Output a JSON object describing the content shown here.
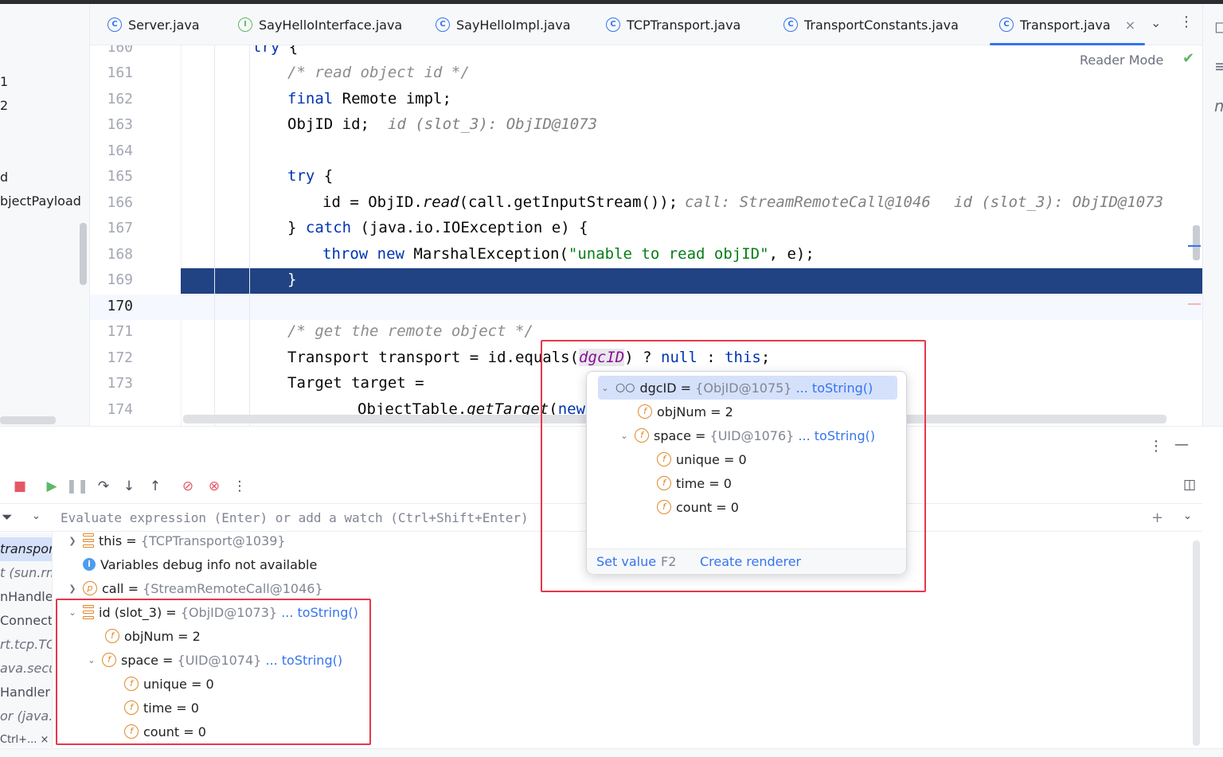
{
  "left_panel": {
    "items": [
      "1",
      "2",
      "d",
      "bjectPayload"
    ]
  },
  "tabs": [
    {
      "label": "Server.java",
      "icon": "class-icon"
    },
    {
      "label": "SayHelloInterface.java",
      "icon": "interface-icon"
    },
    {
      "label": "SayHelloImpl.java",
      "icon": "class-icon"
    },
    {
      "label": "TCPTransport.java",
      "icon": "class-icon"
    },
    {
      "label": "TransportConstants.java",
      "icon": "class-icon"
    },
    {
      "label": "Transport.java",
      "icon": "class-icon",
      "active": true
    }
  ],
  "tab_icon_letters": {
    "class": "C",
    "interface": "I"
  },
  "editor": {
    "reader_mode": "Reader Mode",
    "line_numbers": [
      "160",
      "161",
      "162",
      "163",
      "164",
      "165",
      "166",
      "167",
      "168",
      "169",
      "170",
      "171",
      "172",
      "173",
      "174"
    ],
    "current_line": "170",
    "selected_line": "169",
    "code": {
      "l160_kw": "try",
      "l160_rest": " {",
      "l161": "/* read object id */",
      "l162_kw": "final",
      "l162_rest": " Remote impl;",
      "l163": "ObjID id;",
      "l163_hint": "id (slot_3): ObjID@1073",
      "l165_kw": "try",
      "l165_rest": " {",
      "l166_a": "id = ObjID.",
      "l166_b": "read",
      "l166_c": "(call.getInputStream());",
      "l166_hint1": "call: StreamRemoteCall@1046",
      "l166_hint2": "id (slot_3): ObjID@1073",
      "l167_a": "} ",
      "l167_kw": "catch",
      "l167_b": " (java.io.IOException e) {",
      "l168_kw1": "throw",
      "l168_kw2": "new",
      "l168_a": " MarshalException(",
      "l168_str": "\"unable to read objID\"",
      "l168_b": ", e);",
      "l169": "}",
      "l171": "/* get the remote object */",
      "l172_a": "Transport transport = id.equals(",
      "l172_var": "dgcID",
      "l172_b": ") ? ",
      "l172_kw1": "null",
      "l172_c": " : ",
      "l172_kw2": "this",
      "l172_d": ";",
      "l173": "Target target =",
      "l174_a": "ObjectTable.",
      "l174_b": "getTarget",
      "l174_c": "(",
      "l174_kw": "new"
    }
  },
  "debug": {
    "watch_placeholder": "Evaluate expression (Enter) or add a watch (Ctrl+Shift+Enter)",
    "frames": [
      "transpor",
      "t (sun.rm",
      "nHandle",
      "Connect",
      "rt.tcp.TC",
      "ava.secu",
      "Handler",
      "or (java.u",
      "Ctrl+... ×"
    ],
    "variables": [
      {
        "name": "this",
        "eq": " = ",
        "type": "{TCPTransport@1039}",
        "link": ""
      },
      {
        "name": "Variables debug info not available"
      },
      {
        "name": "call",
        "eq": " = ",
        "type": "{StreamRemoteCall@1046}",
        "link": ""
      },
      {
        "name": "id (slot_3)",
        "eq": " = ",
        "type": "{ObjID@1073}",
        "link": "... toString()"
      },
      {
        "name": "objNum",
        "eq": " = ",
        "value": "2"
      },
      {
        "name": "space",
        "eq": " = ",
        "type": "{UID@1074}",
        "link": "... toString()"
      },
      {
        "name": "unique",
        "eq": " = ",
        "value": "0"
      },
      {
        "name": "time",
        "eq": " = ",
        "value": "0"
      },
      {
        "name": "count",
        "eq": " = ",
        "value": "0"
      }
    ]
  },
  "popup": {
    "rows": [
      {
        "name": "dgcID",
        "eq": " = ",
        "type": "{ObjID@1075}",
        "link": "... toString()"
      },
      {
        "name": "objNum",
        "eq": " = ",
        "value": "2"
      },
      {
        "name": "space",
        "eq": " = ",
        "type": "{UID@1076}",
        "link": "... toString()"
      },
      {
        "name": "unique",
        "eq": " = ",
        "value": "0"
      },
      {
        "name": "time",
        "eq": " = ",
        "value": "0"
      },
      {
        "name": "count",
        "eq": " = ",
        "value": "0"
      }
    ],
    "set_value": "Set value",
    "set_value_key": "F2",
    "create_renderer": "Create renderer"
  },
  "colors": {
    "accent": "#3574f0",
    "selection": "#214283",
    "annotation": "#e8374a",
    "field_icon": "#e0882a"
  }
}
